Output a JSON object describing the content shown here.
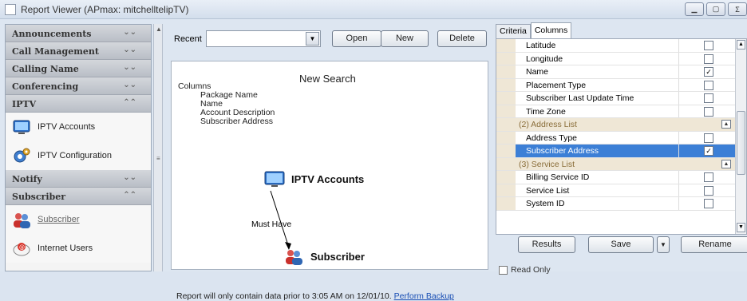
{
  "window": {
    "title": "Report Viewer (APmax: mitchelltelipTV)"
  },
  "leftnav": {
    "sections": [
      {
        "label": "Announcements",
        "expanded": false
      },
      {
        "label": "Call Management",
        "expanded": false
      },
      {
        "label": "Calling Name",
        "expanded": false
      },
      {
        "label": "Conferencing",
        "expanded": false
      },
      {
        "label": "IPTV",
        "expanded": true,
        "items": [
          "IPTV Accounts",
          "IPTV Configuration"
        ]
      },
      {
        "label": "Notify",
        "expanded": false
      },
      {
        "label": "Subscriber",
        "expanded": true,
        "items": [
          "Subscriber",
          "Internet Users"
        ]
      }
    ]
  },
  "toolbar": {
    "recent_label": "Recent",
    "recent_value": "",
    "open_label": "Open",
    "new_label": "New",
    "delete_label": "Delete"
  },
  "canvas": {
    "title": "New Search",
    "columns_heading": "Columns",
    "columns": [
      "Package Name",
      "Name",
      "Account Description",
      "Subscriber Address"
    ],
    "node_primary": "IPTV Accounts",
    "relation": "Must  Have",
    "node_secondary": "Subscriber",
    "footnote": "Report will only contain data prior to 3:05 AM  on 12/01/10.",
    "footnote_link": "Perform Backup"
  },
  "right": {
    "tabs": [
      "Criteria",
      "Columns"
    ],
    "active_tab": "Columns",
    "rows": [
      {
        "type": "field",
        "name": "Latitude",
        "checked": false
      },
      {
        "type": "field",
        "name": "Longitude",
        "checked": false
      },
      {
        "type": "field",
        "name": "Name",
        "checked": true
      },
      {
        "type": "field",
        "name": "Placement Type",
        "checked": false
      },
      {
        "type": "field",
        "name": "Subscriber Last Update Time",
        "checked": false
      },
      {
        "type": "field",
        "name": "Time Zone",
        "checked": false
      },
      {
        "type": "group",
        "name": "(2) Address List"
      },
      {
        "type": "field",
        "name": "Address Type",
        "checked": false
      },
      {
        "type": "field",
        "name": "Subscriber Address",
        "checked": true,
        "selected": true
      },
      {
        "type": "group",
        "name": "(3) Service List"
      },
      {
        "type": "field",
        "name": "Billing Service ID",
        "checked": false
      },
      {
        "type": "field",
        "name": "Service List",
        "checked": false
      },
      {
        "type": "field",
        "name": "System ID",
        "checked": false
      }
    ],
    "results_label": "Results",
    "save_label": "Save",
    "rename_label": "Rename",
    "readonly_label": "Read Only"
  },
  "colors": {
    "selection": "#3c7fd6",
    "group_bg": "#efe7d6",
    "nav_header": "#c3c8cf",
    "link": "#1a4fb4"
  }
}
